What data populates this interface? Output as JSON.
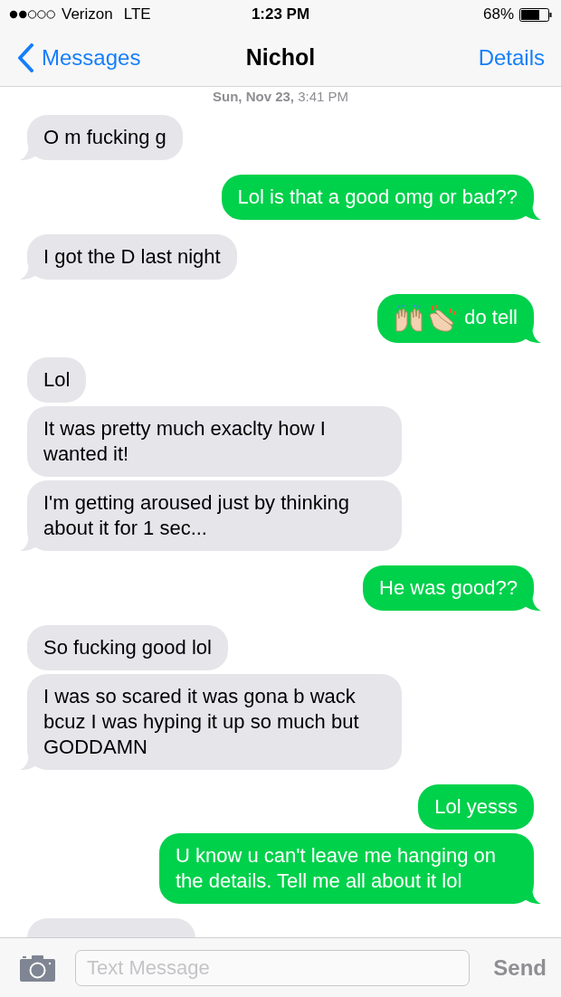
{
  "status_bar": {
    "carrier": "Verizon",
    "network": "LTE",
    "time": "1:23 PM",
    "battery": "68%"
  },
  "nav_bar": {
    "back": "Messages",
    "title": "Nichol",
    "action": "Details"
  },
  "timestamp": "**Sun, Nov 23,** 3:41 PM",
  "messages": [
    {
      "kind": "received",
      "text": "O m fucking g"
    },
    {
      "kind": "sent",
      "text": "Lol is that a good omg or bad??"
    },
    {
      "kind": "received",
      "text": "I got the D last night"
    },
    {
      "kind": "sent",
      "emoji": true,
      "text": "do tell"
    },
    {
      "kind": "received",
      "text": "Lol"
    },
    {
      "kind": "received",
      "text": "It was pretty much exaclty how I wanted it!"
    },
    {
      "kind": "received",
      "text": "I'm getting aroused just by thinking about it for 1 sec..."
    },
    {
      "kind": "sent",
      "text": "He was good??"
    },
    {
      "kind": "received",
      "text": "So fucking good lol"
    },
    {
      "kind": "received",
      "text": "I was so scared it was gona b wack bcuz I was hyping it up so much but GODDAMN"
    },
    {
      "kind": "sent",
      "text": "Lol yesss"
    },
    {
      "kind": "sent",
      "text": "U know u can't leave me hanging on the details. Tell me all about it lol"
    }
  ],
  "compose": {
    "placeholder": "Text Message",
    "send": "Send"
  }
}
